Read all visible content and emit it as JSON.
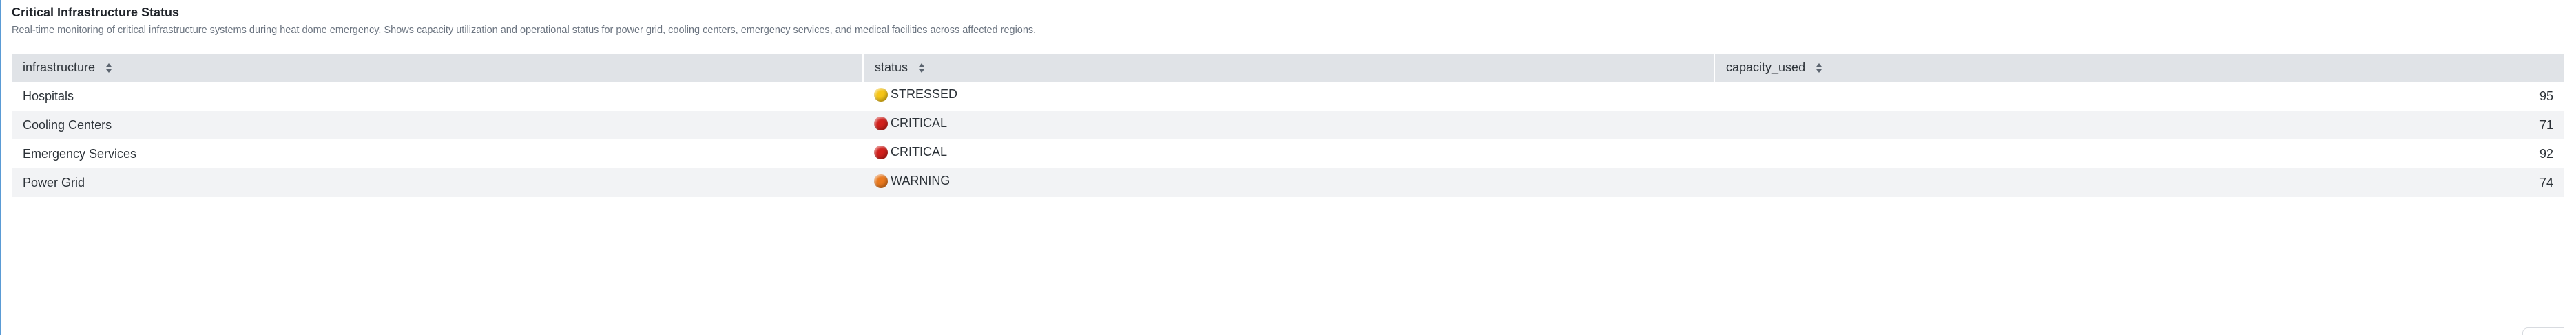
{
  "panel": {
    "title": "Critical Infrastructure Status",
    "description": "Real-time monitoring of critical infrastructure systems during heat dome emergency. Shows capacity utilization and operational status for power grid, cooling centers, emergency services, and medical facilities across affected regions."
  },
  "table": {
    "columns": [
      {
        "label": "infrastructure",
        "sort_icon": "sort-icon"
      },
      {
        "label": "status",
        "sort_icon": "sort-icon"
      },
      {
        "label": "capacity_used",
        "sort_icon": "sort-icon"
      }
    ],
    "rows": [
      {
        "infrastructure": "Hospitals",
        "status": "STRESSED",
        "status_color": "#f5c518",
        "capacity_used": "95"
      },
      {
        "infrastructure": "Cooling Centers",
        "status": "CRITICAL",
        "status_color": "#d0201c",
        "capacity_used": "71"
      },
      {
        "infrastructure": "Emergency Services",
        "status": "CRITICAL",
        "status_color": "#d0201c",
        "capacity_used": "92"
      },
      {
        "infrastructure": "Power Grid",
        "status": "WARNING",
        "status_color": "#e8781e",
        "capacity_used": "74"
      }
    ]
  },
  "colors": {
    "header_bg": "#e0e3e7",
    "row_alt_bg": "#f2f3f5",
    "accent_rule": "#5a9bd5"
  }
}
